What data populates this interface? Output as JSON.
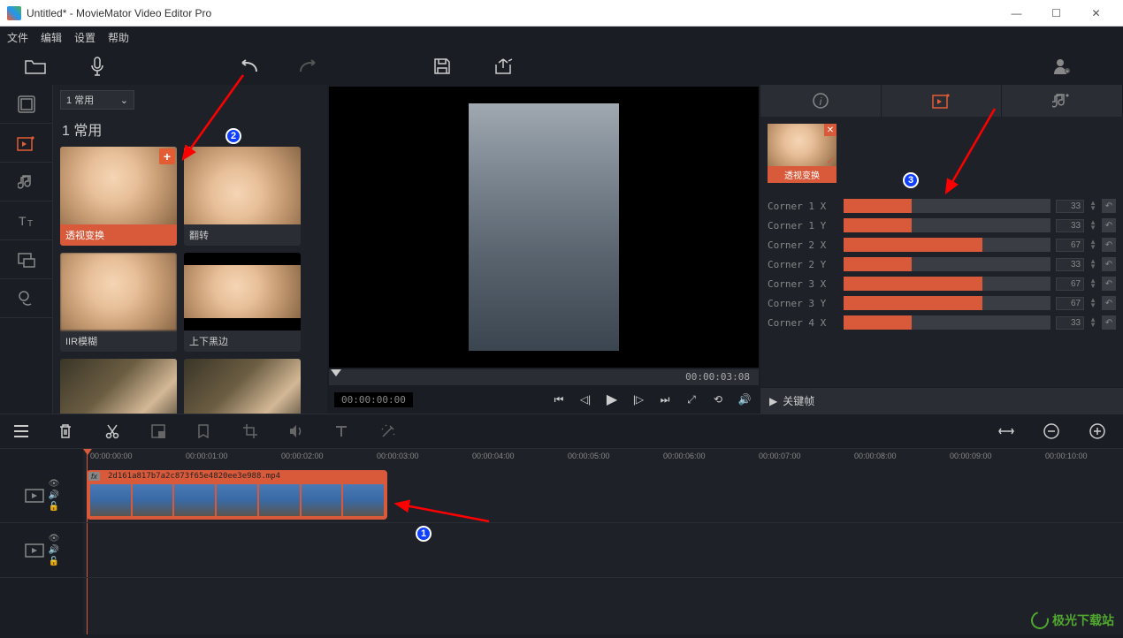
{
  "window": {
    "title": "Untitled* - MovieMator Video Editor Pro",
    "minimize": "—",
    "maximize": "☐",
    "close": "✕"
  },
  "menu": {
    "file": "文件",
    "edit": "编辑",
    "settings": "设置",
    "help": "帮助"
  },
  "effects": {
    "dropdown": "1 常用",
    "category": "1 常用",
    "items": [
      {
        "label": "透视变换",
        "selected": true
      },
      {
        "label": "翻转",
        "selected": false
      },
      {
        "label": "IIR模糊",
        "selected": false
      },
      {
        "label": "上下黑边",
        "selected": false
      }
    ]
  },
  "preview": {
    "scrub_time": "00:00:03:08",
    "time_display": "00:00:00:00"
  },
  "props": {
    "chip_label": "透视变换",
    "sliders": [
      {
        "label": "Corner 1 X",
        "value": 33
      },
      {
        "label": "Corner 1 Y",
        "value": 33
      },
      {
        "label": "Corner 2 X",
        "value": 67
      },
      {
        "label": "Corner 2 Y",
        "value": 33
      },
      {
        "label": "Corner 3 X",
        "value": 67
      },
      {
        "label": "Corner 3 Y",
        "value": 67
      },
      {
        "label": "Corner 4 X",
        "value": 33
      }
    ],
    "keyframe_label": "关键帧"
  },
  "timeline": {
    "ticks": [
      "00:00:00:00",
      "00:00:01:00",
      "00:00:02:00",
      "00:00:03:00",
      "00:00:04:00",
      "00:00:05:00",
      "00:00:06:00",
      "00:00:07:00",
      "00:00:08:00",
      "00:00:09:00",
      "00:00:10:00"
    ],
    "clip_name": "2d161a817b7a2c873f65e4820ee3e988.mp4",
    "fx_badge": "fx"
  },
  "watermark": "极光下载站",
  "badges": {
    "b1": "1",
    "b2": "2",
    "b3": "3"
  }
}
